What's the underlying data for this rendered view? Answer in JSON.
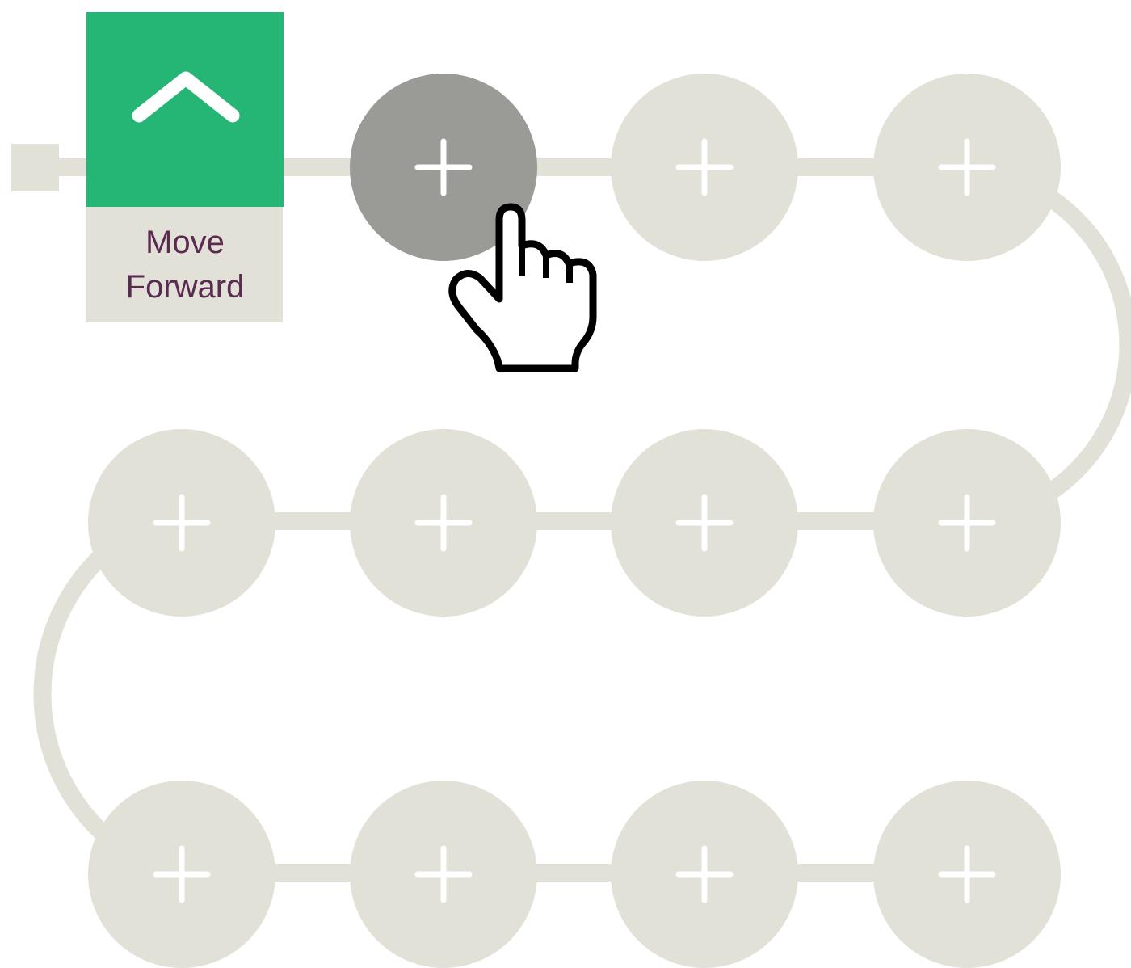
{
  "program": {
    "blocks": [
      {
        "label_line1": "Move",
        "label_line2": "Forward",
        "icon": "chevron-up-icon",
        "color": "#25b574"
      }
    ],
    "slots": [
      {
        "row": 1,
        "col": 1,
        "state": "active",
        "icon": "plus-icon"
      },
      {
        "row": 1,
        "col": 2,
        "state": "empty",
        "icon": "plus-icon"
      },
      {
        "row": 1,
        "col": 3,
        "state": "empty",
        "icon": "plus-icon"
      },
      {
        "row": 2,
        "col": 0,
        "state": "empty",
        "icon": "plus-icon"
      },
      {
        "row": 2,
        "col": 1,
        "state": "empty",
        "icon": "plus-icon"
      },
      {
        "row": 2,
        "col": 2,
        "state": "empty",
        "icon": "plus-icon"
      },
      {
        "row": 2,
        "col": 3,
        "state": "empty",
        "icon": "plus-icon"
      },
      {
        "row": 3,
        "col": 0,
        "state": "empty",
        "icon": "plus-icon"
      },
      {
        "row": 3,
        "col": 1,
        "state": "empty",
        "icon": "plus-icon"
      },
      {
        "row": 3,
        "col": 2,
        "state": "empty",
        "icon": "plus-icon"
      },
      {
        "row": 3,
        "col": 3,
        "state": "empty",
        "icon": "plus-icon"
      }
    ]
  },
  "cursor": {
    "icon": "hand-pointer-icon"
  },
  "colors": {
    "track": "#e1e1d8",
    "slot_empty": "#e1e1d8",
    "slot_active": "#9a9b96",
    "block_green": "#25b574",
    "block_label_bg": "#e1e1d8",
    "label_text": "#5a2a50"
  }
}
